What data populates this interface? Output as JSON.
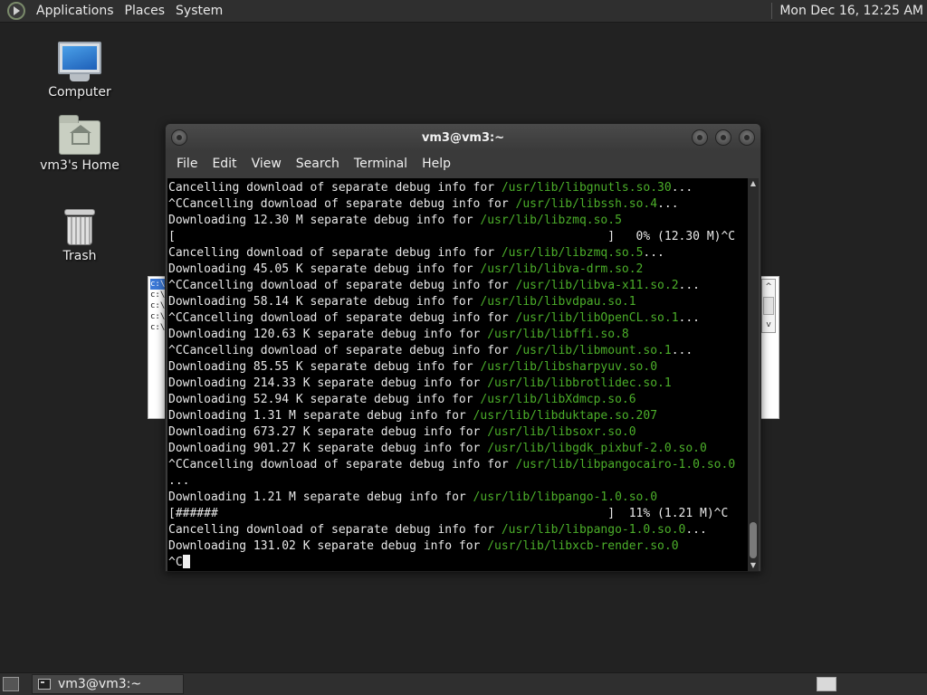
{
  "top_panel": {
    "menus": [
      "Applications",
      "Places",
      "System"
    ],
    "clock": "Mon Dec 16, 12:25 AM"
  },
  "desktop_icons": [
    {
      "label": "Computer",
      "icon": "computer-icon"
    },
    {
      "label": "vm3's Home",
      "icon": "home-folder-icon"
    },
    {
      "label": "Trash",
      "icon": "trash-icon"
    }
  ],
  "background_window": {
    "lines": [
      "c:\\",
      "c:\\",
      "c:\\",
      "c:\\",
      "c:\\"
    ],
    "scroll_up": "^",
    "scroll_down": "v"
  },
  "terminal": {
    "title": "vm3@vm3:~",
    "menu": [
      "File",
      "Edit",
      "View",
      "Search",
      "Terminal",
      "Help"
    ],
    "lines": [
      {
        "text": "Cancelling download of separate debug info for ",
        "path": "/usr/lib/libgnutls.so.30",
        "tail": "..."
      },
      {
        "text": "^CCancelling download of separate debug info for ",
        "path": "/usr/lib/libssh.so.4",
        "tail": "..."
      },
      {
        "text": "Downloading 12.30 M separate debug info for ",
        "path": "/usr/lib/libzmq.so.5",
        "tail": ""
      },
      {
        "text": "[                                                             ]   0% (12.30 M)^C",
        "path": "",
        "tail": ""
      },
      {
        "text": "Cancelling download of separate debug info for ",
        "path": "/usr/lib/libzmq.so.5",
        "tail": "..."
      },
      {
        "text": "Downloading 45.05 K separate debug info for ",
        "path": "/usr/lib/libva-drm.so.2",
        "tail": ""
      },
      {
        "text": "^CCancelling download of separate debug info for ",
        "path": "/usr/lib/libva-x11.so.2",
        "tail": "..."
      },
      {
        "text": "Downloading 58.14 K separate debug info for ",
        "path": "/usr/lib/libvdpau.so.1",
        "tail": ""
      },
      {
        "text": "^CCancelling download of separate debug info for ",
        "path": "/usr/lib/libOpenCL.so.1",
        "tail": "..."
      },
      {
        "text": "Downloading 120.63 K separate debug info for ",
        "path": "/usr/lib/libffi.so.8",
        "tail": ""
      },
      {
        "text": "^CCancelling download of separate debug info for ",
        "path": "/usr/lib/libmount.so.1",
        "tail": "..."
      },
      {
        "text": "Downloading 85.55 K separate debug info for ",
        "path": "/usr/lib/libsharpyuv.so.0",
        "tail": ""
      },
      {
        "text": "Downloading 214.33 K separate debug info for ",
        "path": "/usr/lib/libbrotlidec.so.1",
        "tail": ""
      },
      {
        "text": "Downloading 52.94 K separate debug info for ",
        "path": "/usr/lib/libXdmcp.so.6",
        "tail": ""
      },
      {
        "text": "Downloading 1.31 M separate debug info for ",
        "path": "/usr/lib/libduktape.so.207",
        "tail": ""
      },
      {
        "text": "Downloading 673.27 K separate debug info for ",
        "path": "/usr/lib/libsoxr.so.0",
        "tail": ""
      },
      {
        "text": "Downloading 901.27 K separate debug info for ",
        "path": "/usr/lib/libgdk_pixbuf-2.0.so.0",
        "tail": ""
      },
      {
        "text": "^CCancelling download of separate debug info for ",
        "path": "/usr/lib/libpangocairo-1.0.so.0",
        "tail": ""
      },
      {
        "text": "...",
        "path": "",
        "tail": ""
      },
      {
        "text": "Downloading 1.21 M separate debug info for ",
        "path": "/usr/lib/libpango-1.0.so.0",
        "tail": ""
      },
      {
        "text": "[######                                                       ]  11% (1.21 M)^C",
        "path": "",
        "tail": ""
      },
      {
        "text": "Cancelling download of separate debug info for ",
        "path": "/usr/lib/libpango-1.0.so.0",
        "tail": "..."
      },
      {
        "text": "Downloading 131.02 K separate debug info for ",
        "path": "/usr/lib/libxcb-render.so.0",
        "tail": ""
      }
    ],
    "prompt": "^C"
  },
  "bottom_panel": {
    "task_label": "vm3@vm3:~"
  },
  "colors": {
    "desktop_bg": "#222222",
    "panel_bg": "#2f2f2f",
    "terminal_bg": "#000000",
    "path_green": "#4caf2a"
  }
}
